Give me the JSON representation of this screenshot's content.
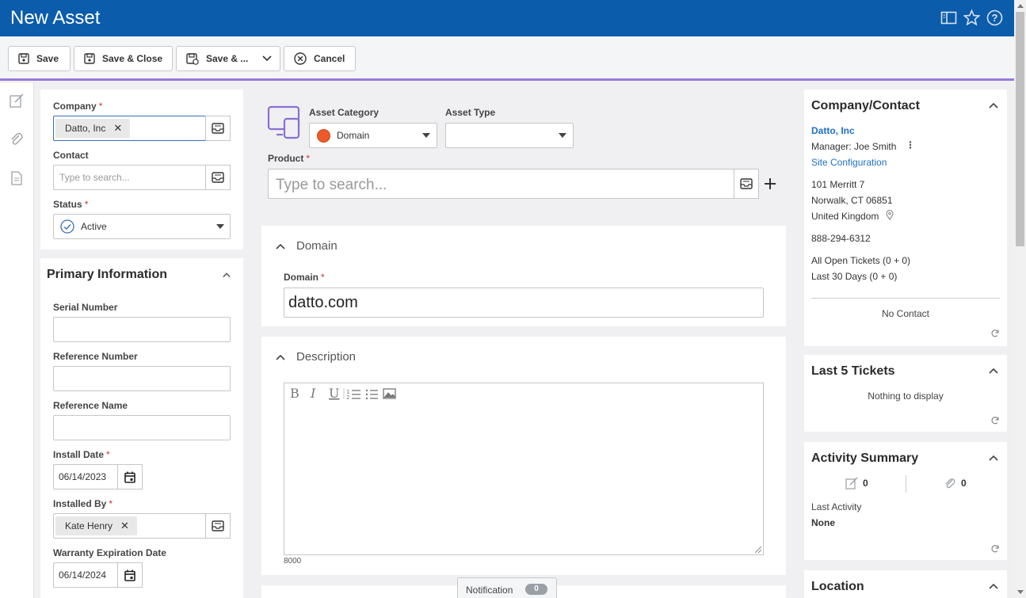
{
  "header": {
    "title": "New Asset"
  },
  "toolbar": {
    "save": "Save",
    "save_close": "Save & Close",
    "save_more": "Save & ...",
    "cancel": "Cancel"
  },
  "form": {
    "company": {
      "label": "Company",
      "value": "Datto, Inc"
    },
    "contact": {
      "label": "Contact",
      "placeholder": "Type to search..."
    },
    "status": {
      "label": "Status",
      "value": "Active"
    },
    "primary_info": {
      "title": "Primary Information",
      "serial_number": {
        "label": "Serial Number",
        "value": ""
      },
      "reference_number": {
        "label": "Reference Number",
        "value": ""
      },
      "reference_name": {
        "label": "Reference Name",
        "value": ""
      },
      "install_date": {
        "label": "Install Date",
        "value": "06/14/2023"
      },
      "installed_by": {
        "label": "Installed By",
        "value": "Kate Henry"
      },
      "warranty_expiration": {
        "label": "Warranty Expiration Date",
        "value": "06/14/2024"
      }
    },
    "asset_category": {
      "label": "Asset Category",
      "value": "Domain",
      "color": "#f05a28"
    },
    "asset_type": {
      "label": "Asset Type",
      "value": ""
    },
    "product": {
      "label": "Product",
      "placeholder": "Type to search..."
    },
    "domain_section": {
      "title": "Domain",
      "field_label": "Domain",
      "value": "datto.com"
    },
    "description_section": {
      "title": "Description",
      "char_count": "8000"
    }
  },
  "right": {
    "company_contact": {
      "title": "Company/Contact",
      "company_link": "Datto, Inc",
      "manager": "Manager: Joe Smith",
      "site_config": "Site Configuration",
      "address1": "101 Merritt 7",
      "address2": "Norwalk, CT 06851",
      "country": "United Kingdom",
      "phone": "888-294-6312",
      "open_tickets": "All Open Tickets (0 + 0)",
      "last30": "Last 30 Days (0 + 0)",
      "no_contact": "No Contact"
    },
    "last_tickets": {
      "title": "Last 5 Tickets",
      "empty": "Nothing to display"
    },
    "activity": {
      "title": "Activity Summary",
      "notes_count": "0",
      "attach_count": "0",
      "last_activity_label": "Last Activity",
      "last_activity_value": "None"
    },
    "location": {
      "title": "Location"
    }
  },
  "notification": {
    "label": "Notification",
    "count": "0"
  },
  "colors": {
    "brand": "#0b5cab",
    "accent": "#9a7ad8",
    "required": "#d0342c",
    "link": "#1f6fc5"
  }
}
